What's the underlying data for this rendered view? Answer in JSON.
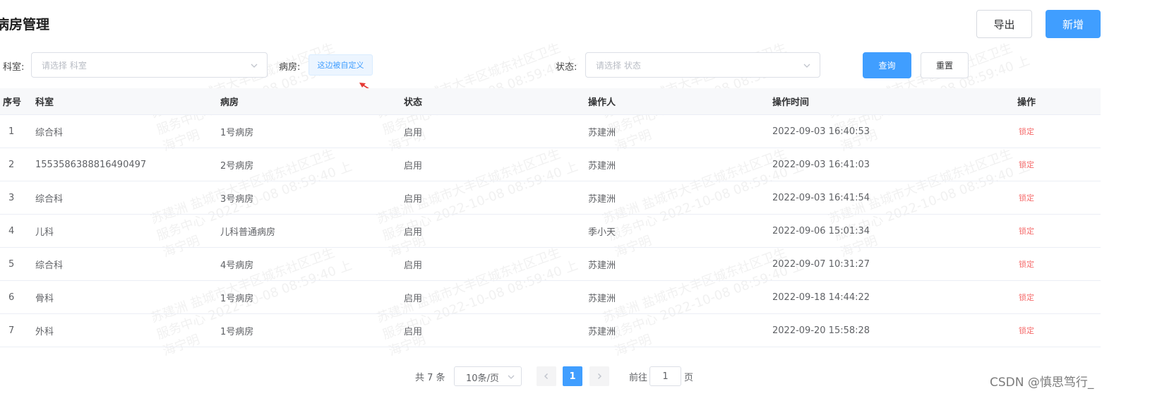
{
  "page": {
    "title": "病房管理"
  },
  "toolbar": {
    "export_label": "导出",
    "add_label": "新增"
  },
  "filters": {
    "dept_label": "科室:",
    "dept_placeholder": "请选择 科室",
    "ward_label": "病房:",
    "ward_custom_text": "这边被自定义",
    "status_label": "状态:",
    "status_placeholder": "请选择 状态",
    "query_label": "查询",
    "reset_label": "重置",
    "annotation_arrow_color": "#e53935"
  },
  "table": {
    "headers": [
      "序号",
      "科室",
      "病房",
      "状态",
      "操作人",
      "操作时间",
      "操作"
    ],
    "rows": [
      {
        "idx": "1",
        "dept": "综合科",
        "ward": "1号病房",
        "status": "启用",
        "operator": "苏建洲",
        "time": "2022-09-03 16:40:53",
        "action": "锁定"
      },
      {
        "idx": "2",
        "dept": "1553586388816490497",
        "ward": "2号病房",
        "status": "启用",
        "operator": "苏建洲",
        "time": "2022-09-03 16:41:03",
        "action": "锁定"
      },
      {
        "idx": "3",
        "dept": "综合科",
        "ward": "3号病房",
        "status": "启用",
        "operator": "苏建洲",
        "time": "2022-09-03 16:41:54",
        "action": "锁定"
      },
      {
        "idx": "4",
        "dept": "儿科",
        "ward": "儿科普通病房",
        "status": "启用",
        "operator": "季小天",
        "time": "2022-09-06 15:01:34",
        "action": "锁定"
      },
      {
        "idx": "5",
        "dept": "综合科",
        "ward": "4号病房",
        "status": "启用",
        "operator": "苏建洲",
        "time": "2022-09-07 10:31:27",
        "action": "锁定"
      },
      {
        "idx": "6",
        "dept": "骨科",
        "ward": "1号病房",
        "status": "启用",
        "operator": "苏建洲",
        "time": "2022-09-18 14:44:22",
        "action": "锁定"
      },
      {
        "idx": "7",
        "dept": "外科",
        "ward": "1号病房",
        "status": "启用",
        "operator": "苏建洲",
        "time": "2022-09-20 15:58:28",
        "action": "锁定"
      }
    ]
  },
  "pagination": {
    "total_text": "共 7 条",
    "page_size": "10条/页",
    "current_page": "1",
    "goto_label": "前往",
    "goto_value": "1",
    "goto_unit": "页"
  },
  "watermark": {
    "line1": "苏建洲 盐城市大丰区城东社区卫生",
    "line2": "服务中心 2022-10-08 08:59:40 上",
    "line3": "海宁明"
  },
  "credit": "CSDN @慎思笃行_",
  "colors": {
    "primary": "#409eff",
    "danger": "#f56c6c",
    "header_bg": "#f7f8fa"
  }
}
